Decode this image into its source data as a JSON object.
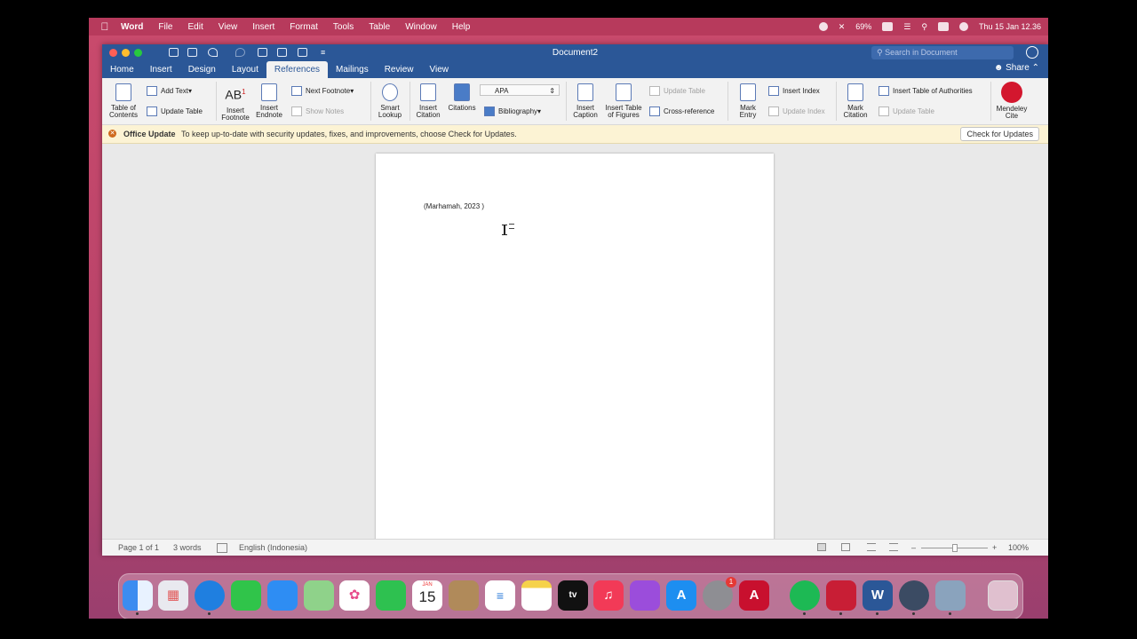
{
  "menubar": {
    "app": "Word",
    "items": [
      "File",
      "Edit",
      "View",
      "Insert",
      "Format",
      "Tools",
      "Table",
      "Window",
      "Help"
    ],
    "battery": "69%",
    "clock": "Thu 15 Jan  12.36"
  },
  "window": {
    "title": "Document2",
    "search_placeholder": "Search in Document",
    "share_label": "Share",
    "tabs": [
      "Home",
      "Insert",
      "Design",
      "Layout",
      "References",
      "Mailings",
      "Review",
      "View"
    ],
    "active_tab": "References"
  },
  "ribbon": {
    "table_of_contents": [
      "Table of",
      "Contents"
    ],
    "add_text": "Add Text",
    "update_table": "Update Table",
    "insert_footnote": [
      "Insert",
      "Footnote"
    ],
    "insert_endnote": [
      "Insert",
      "Endnote"
    ],
    "next_footnote": "Next Footnote",
    "show_notes": "Show Notes",
    "smart_lookup": [
      "Smart",
      "Lookup"
    ],
    "insert_citation": [
      "Insert",
      "Citation"
    ],
    "citations": "Citations",
    "style_value": "APA",
    "bibliography": "Bibliography",
    "insert_caption": [
      "Insert",
      "Caption"
    ],
    "insert_table_of_figures": [
      "Insert Table",
      "of Figures"
    ],
    "update_table_figures": "Update Table",
    "cross_reference": "Cross-reference",
    "mark_entry": [
      "Mark",
      "Entry"
    ],
    "insert_index": "Insert Index",
    "update_index": "Update Index",
    "mark_citation": [
      "Mark",
      "Citation"
    ],
    "insert_table_of_authorities": "Insert Table of Authorities",
    "update_table_authorities": "Update Table",
    "mendeley_cite": [
      "Mendeley",
      "Cite"
    ]
  },
  "notice": {
    "title": "Office Update",
    "message": "To keep up-to-date with security updates, fixes, and improvements, choose Check for Updates.",
    "button": "Check for Updates"
  },
  "document": {
    "text": "(Marhamah, 2023 )"
  },
  "status": {
    "page": "Page 1 of 1",
    "words": "3 words",
    "language": "English (Indonesia)",
    "zoom": "100%"
  },
  "dock": {
    "calendar_month": "JAN",
    "calendar_day": "15",
    "settings_badge": "1",
    "items": [
      "Finder",
      "Launchpad",
      "Safari",
      "Messages",
      "Mail",
      "Maps",
      "Photos",
      "FaceTime",
      "Calendar",
      "Contacts",
      "Reminders",
      "Notes",
      "TV",
      "Music",
      "Podcasts",
      "App Store",
      "System Preferences",
      "Acrobat",
      "Spotify",
      "Mendeley",
      "Word",
      "QuickTime",
      "Preview",
      "Trash"
    ]
  },
  "colors": {
    "accent": "#2b5797",
    "wallpaper": "#c94a6c",
    "notice_bg": "#fcf3d4"
  }
}
